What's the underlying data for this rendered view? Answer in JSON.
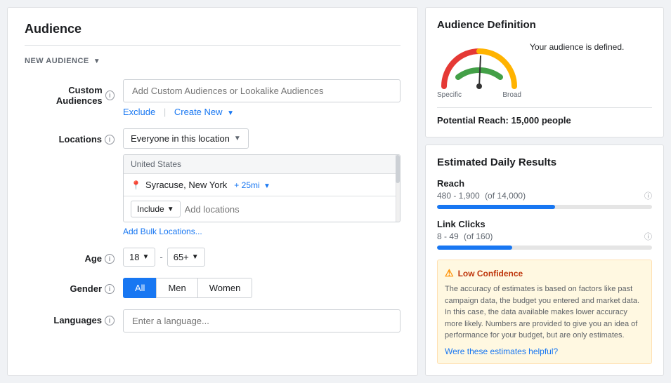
{
  "page": {
    "title": "Audience"
  },
  "new_audience": {
    "label": "NEW AUDIENCE"
  },
  "form": {
    "custom_audiences": {
      "label": "Custom Audiences",
      "placeholder": "Add Custom Audiences or Lookalike Audiences",
      "exclude_label": "Exclude",
      "create_new_label": "Create New"
    },
    "locations": {
      "label": "Locations",
      "dropdown_label": "Everyone in this location",
      "country": "United States",
      "location_name": "Syracuse, New York",
      "location_radius": "+ 25mi",
      "include_label": "Include",
      "add_locations_placeholder": "Add locations",
      "add_bulk_label": "Add Bulk Locations..."
    },
    "age": {
      "label": "Age",
      "min": "18",
      "max": "65+",
      "dash": "-"
    },
    "gender": {
      "label": "Gender",
      "buttons": [
        "All",
        "Men",
        "Women"
      ],
      "active": "All"
    },
    "languages": {
      "label": "Languages",
      "placeholder": "Enter a language..."
    }
  },
  "audience_definition": {
    "title": "Audience Definition",
    "gauge_specific": "Specific",
    "gauge_broad": "Broad",
    "status_text": "Your audience is defined.",
    "potential_reach_label": "Potential Reach:",
    "potential_reach_value": "15,000 people"
  },
  "estimated_results": {
    "title": "Estimated Daily Results",
    "reach": {
      "label": "Reach",
      "value": "480 - 1,900",
      "sub": "(of 14,000)",
      "progress": 55
    },
    "link_clicks": {
      "label": "Link Clicks",
      "value": "8 - 49",
      "sub": "(of 160)",
      "progress": 35
    },
    "low_confidence": {
      "title": "Low Confidence",
      "text": "The accuracy of estimates is based on factors like past campaign data, the budget you entered and market data. In this case, the data available makes lower accuracy more likely. Numbers are provided to give you an idea of performance for your budget, but are only estimates.",
      "helpful_text": "Were these estimates helpful?"
    }
  }
}
